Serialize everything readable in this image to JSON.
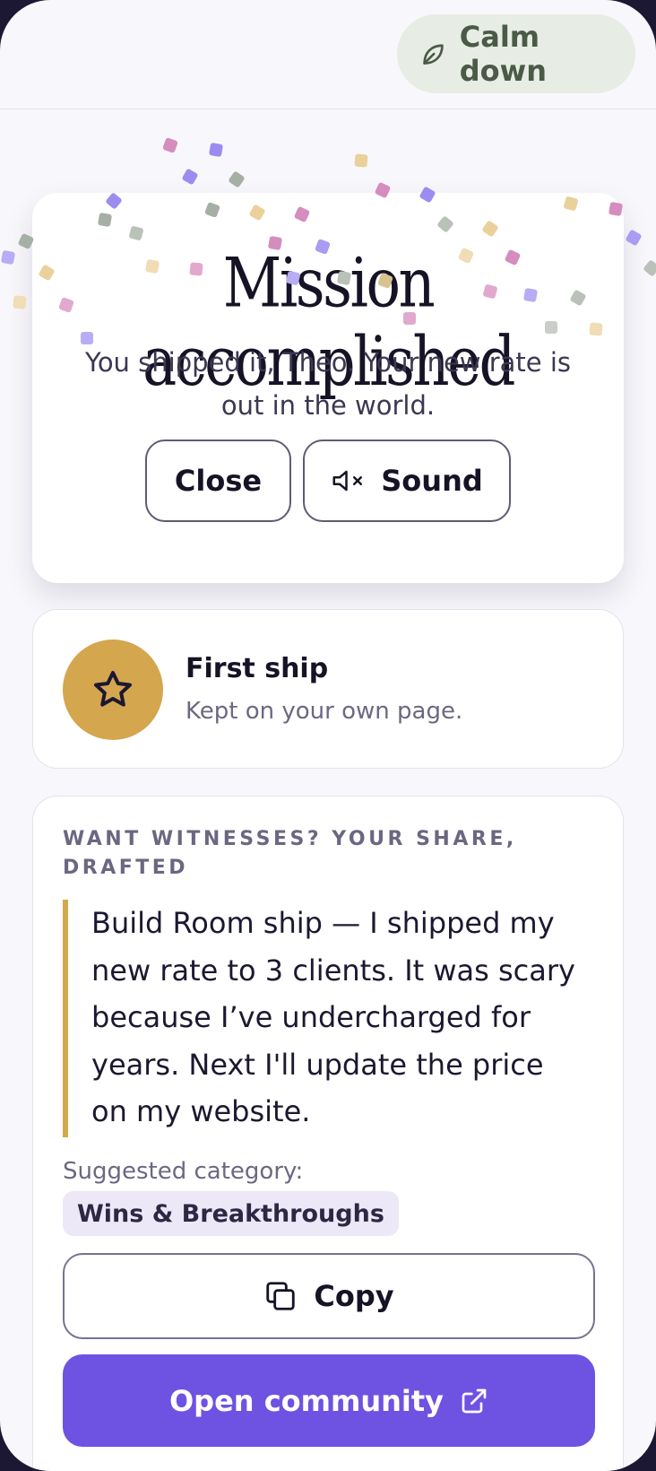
{
  "topbar": {
    "calm_label": "Calm down",
    "calm_icon": "leaf-icon"
  },
  "mission": {
    "title": "Mission accomplished",
    "subtitle": "You shipped it, Theo. Your new rate is out in the world.",
    "close_label": "Close",
    "sound_label": "Sound",
    "sound_icon": "speaker-muted-icon"
  },
  "badge": {
    "title": "First ship",
    "subtitle": "Kept on your own page.",
    "icon": "star-icon",
    "color": "#d4a64e"
  },
  "share": {
    "label": "WANT WITNESSES? YOUR SHARE, DRAFTED",
    "text": "Build Room ship — I shipped my new rate to 3 clients. It was scary because I’ve undercharged for years. Next I'll update the price on my website.",
    "category_label": "Suggested category:",
    "category": "Wins & Breakthroughs",
    "copy_label": "Copy",
    "community_label": "Open community"
  },
  "colors": {
    "accent": "#6e52e2",
    "gold": "#d3a94d",
    "calm_bg": "#e7ece4"
  }
}
